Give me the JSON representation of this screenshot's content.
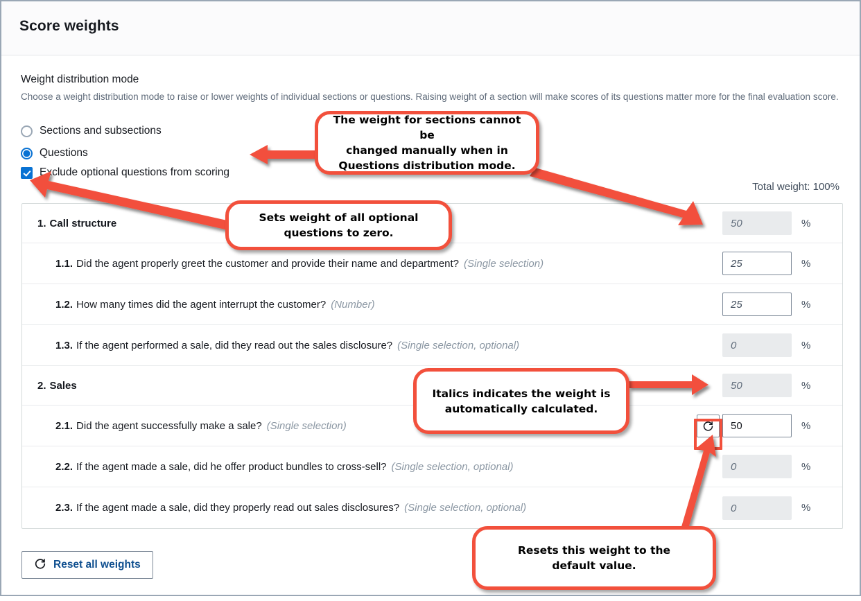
{
  "panel": {
    "title": "Score weights"
  },
  "form": {
    "label": "Weight distribution mode",
    "description": "Choose a weight distribution mode to raise or lower weights of individual sections or questions. Raising weight of a section will make scores of its questions matter more for the final evaluation score.",
    "options": [
      {
        "label": "Sections and subsections",
        "selected": false
      },
      {
        "label": "Questions",
        "selected": true
      }
    ],
    "exclude_optional": {
      "label": "Exclude optional questions from scoring",
      "checked": true
    }
  },
  "table": {
    "total_weight_label": "Total weight: 100%",
    "percent_symbol": "%",
    "rows": [
      {
        "kind": "section",
        "number": "1.",
        "text": "Call structure",
        "type": "",
        "value": "50",
        "state": "disabled-auto",
        "reset": false
      },
      {
        "kind": "question",
        "number": "1.1.",
        "text": "Did the agent properly greet the customer and provide their name and department?",
        "type": "(Single selection)",
        "value": "25",
        "state": "editable-auto",
        "reset": false
      },
      {
        "kind": "question",
        "number": "1.2.",
        "text": "How many times did the agent interrupt the customer?",
        "type": "(Number)",
        "value": "25",
        "state": "editable-auto",
        "reset": false
      },
      {
        "kind": "question",
        "number": "1.3.",
        "text": "If the agent performed a sale, did they read out the sales disclosure?",
        "type": "(Single selection, optional)",
        "value": "0",
        "state": "disabled-auto",
        "reset": false
      },
      {
        "kind": "section",
        "number": "2.",
        "text": "Sales",
        "type": "",
        "value": "50",
        "state": "disabled-auto",
        "reset": false
      },
      {
        "kind": "question",
        "number": "2.1.",
        "text": "Did the agent successfully make a sale?",
        "type": "(Single selection)",
        "value": "50",
        "state": "editable-manual",
        "reset": true
      },
      {
        "kind": "question",
        "number": "2.2.",
        "text": "If the agent made a sale, did he offer product bundles to cross-sell?",
        "type": "(Single selection, optional)",
        "value": "0",
        "state": "disabled-auto",
        "reset": false
      },
      {
        "kind": "question",
        "number": "2.3.",
        "text": "If the agent made a sale, did they properly read out sales disclosures?",
        "type": "(Single selection, optional)",
        "value": "0",
        "state": "disabled-auto",
        "reset": false
      }
    ]
  },
  "footer": {
    "reset_all_label": "Reset all weights",
    "reset_icon": "refresh-icon"
  },
  "annotations": [
    {
      "id": "callout-sections-weight",
      "lines": [
        "The weight for sections cannot be",
        "changed manually when in",
        "Questions distribution mode."
      ]
    },
    {
      "id": "callout-optional-zero",
      "lines": [
        "Sets weight of all optional",
        "questions to zero."
      ]
    },
    {
      "id": "callout-italics-auto",
      "lines": [
        "Italics indicates the weight is",
        "automatically calculated."
      ]
    },
    {
      "id": "callout-reset-default",
      "lines": [
        "Resets this weight to the",
        "default value."
      ]
    }
  ],
  "colors": {
    "accent_blue": "#0972d3",
    "annotation_red": "#f2503c",
    "border_grey": "#d5dbdb",
    "disabled_bg": "#e9ebed"
  }
}
